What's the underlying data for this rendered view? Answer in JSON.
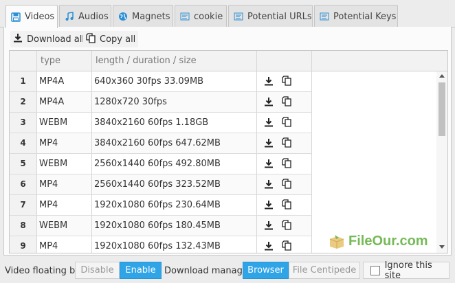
{
  "tabs": [
    {
      "label": "Videos",
      "icon": "save-icon",
      "active": true
    },
    {
      "label": "Audios",
      "icon": "music-note-icon",
      "active": false
    },
    {
      "label": "Magnets",
      "icon": "globe-icon",
      "active": false
    },
    {
      "label": "cookie",
      "icon": "list-icon",
      "active": false
    },
    {
      "label": "Potential URLs",
      "icon": "list-icon",
      "active": false
    },
    {
      "label": "Potential Keys",
      "icon": "list-icon",
      "active": false
    }
  ],
  "toolbar": {
    "download_all": "Download all",
    "copy_all": "Copy all"
  },
  "table": {
    "columns": [
      "",
      "type",
      "length / duration / size",
      "",
      ""
    ],
    "rows": [
      {
        "num": "1",
        "type": "MP4A",
        "info": "640x360 30fps 33.09MB"
      },
      {
        "num": "2",
        "type": "MP4A",
        "info": "1280x720 30fps"
      },
      {
        "num": "3",
        "type": "WEBM",
        "info": "3840x2160 60fps 1.18GB"
      },
      {
        "num": "4",
        "type": "MP4",
        "info": "3840x2160 60fps 647.62MB"
      },
      {
        "num": "5",
        "type": "WEBM",
        "info": "2560x1440 60fps 492.80MB"
      },
      {
        "num": "6",
        "type": "MP4",
        "info": "2560x1440 60fps 323.52MB"
      },
      {
        "num": "7",
        "type": "MP4",
        "info": "1920x1080 60fps 230.64MB"
      },
      {
        "num": "8",
        "type": "WEBM",
        "info": "1920x1080 60fps 180.45MB"
      },
      {
        "num": "9",
        "type": "MP4",
        "info": "1920x1080 60fps 132.43MB"
      }
    ]
  },
  "watermark": "FileOur.com",
  "bottom": {
    "floating_label": "Video floating bar:",
    "disable": "Disable",
    "enable": "Enable",
    "floating_selected": "Enable",
    "manager_label": "Download manager:",
    "browser": "Browser",
    "centipede": "File Centipede",
    "manager_selected": "Browser",
    "ignore_label": "Ignore this site",
    "ignore_checked": false
  },
  "colors": {
    "accent": "#2fa4e7",
    "tab_icon": "#2a8fd6",
    "watermark": "#5fae3b"
  }
}
